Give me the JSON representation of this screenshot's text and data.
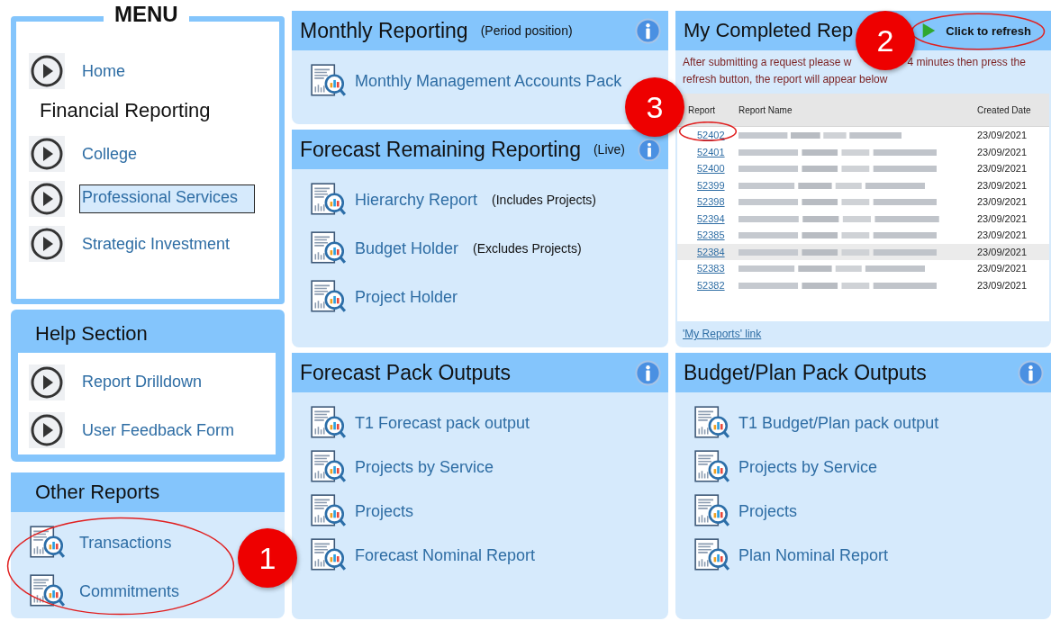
{
  "menu": {
    "title": "MENU",
    "items": [
      {
        "kind": "link",
        "label": "Home",
        "selected": false
      },
      {
        "kind": "heading",
        "label": "Financial Reporting"
      },
      {
        "kind": "link",
        "label": "College",
        "selected": false
      },
      {
        "kind": "link",
        "label": "Professional Services",
        "selected": true
      },
      {
        "kind": "link",
        "label": "Strategic Investment",
        "selected": false
      }
    ]
  },
  "help": {
    "title": "Help Section",
    "items": [
      {
        "label": "Report Drilldown"
      },
      {
        "label": "User Feedback Form"
      }
    ]
  },
  "other_reports": {
    "title": "Other Reports",
    "items": [
      {
        "label": "Transactions"
      },
      {
        "label": "Commitments"
      }
    ]
  },
  "monthly": {
    "title": "Monthly Reporting",
    "note": "(Period position)",
    "items": [
      {
        "label": "Monthly Management Accounts Pack"
      }
    ]
  },
  "forecast_remaining": {
    "title": "Forecast Remaining Reporting",
    "note": "(Live)",
    "items": [
      {
        "label": "Hierarchy Report",
        "note": "(Includes Projects)"
      },
      {
        "label": "Budget Holder",
        "note": "(Excludes Projects)"
      },
      {
        "label": "Project Holder"
      }
    ]
  },
  "forecast_pack": {
    "title": "Forecast Pack Outputs",
    "items": [
      {
        "label": "T1 Forecast pack output"
      },
      {
        "label": "Projects by Service"
      },
      {
        "label": "Projects"
      },
      {
        "label": "Forecast Nominal Report"
      }
    ]
  },
  "completed": {
    "title": "My Completed Rep",
    "refresh": "Click to refresh",
    "notice": [
      "After submitting a request please w",
      "4 minutes then press the",
      "refresh button, the report will appear below"
    ],
    "columns": [
      "Report",
      "Report Name",
      "Created Date"
    ],
    "rows": [
      {
        "id": "52402",
        "date": "23/09/2021",
        "selected": false
      },
      {
        "id": "52401",
        "date": "23/09/2021",
        "selected": false
      },
      {
        "id": "52400",
        "date": "23/09/2021",
        "selected": false
      },
      {
        "id": "52399",
        "date": "23/09/2021",
        "selected": false
      },
      {
        "id": "52398",
        "date": "23/09/2021",
        "selected": false
      },
      {
        "id": "52394",
        "date": "23/09/2021",
        "selected": false
      },
      {
        "id": "52385",
        "date": "23/09/2021",
        "selected": false
      },
      {
        "id": "52384",
        "date": "23/09/2021",
        "selected": true
      },
      {
        "id": "52383",
        "date": "23/09/2021",
        "selected": false
      },
      {
        "id": "52382",
        "date": "23/09/2021",
        "selected": false
      }
    ],
    "link": "'My Reports' link"
  },
  "budget_pack": {
    "title": "Budget/Plan Pack Outputs",
    "items": [
      {
        "label": "T1 Budget/Plan pack output"
      },
      {
        "label": "Projects by Service"
      },
      {
        "label": "Projects"
      },
      {
        "label": "Plan Nominal Report"
      }
    ]
  },
  "annotations": [
    {
      "number": "1"
    },
    {
      "number": "2"
    },
    {
      "number": "3"
    }
  ]
}
